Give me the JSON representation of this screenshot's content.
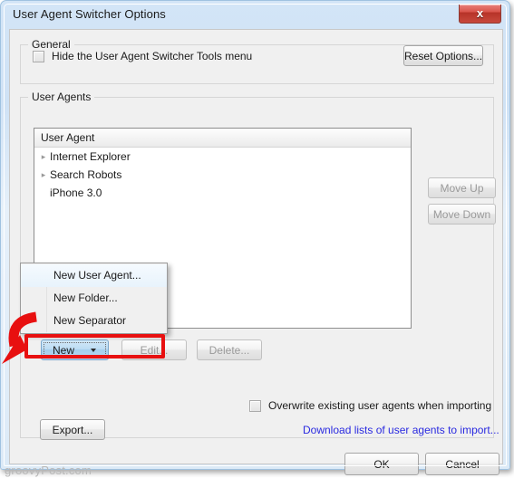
{
  "window": {
    "title": "User Agent Switcher Options",
    "close_glyph": "x"
  },
  "general": {
    "group_label": "General",
    "hide_tools_checkbox": "Hide the User Agent Switcher Tools menu",
    "reset_options_button": "Reset Options..."
  },
  "user_agents": {
    "group_label": "User Agents",
    "column_header": "User Agent",
    "rows": [
      {
        "label": "Internet Explorer",
        "expandable": true,
        "arrow": "▸"
      },
      {
        "label": "Search Robots",
        "expandable": true,
        "arrow": "▸"
      },
      {
        "label": "iPhone 3.0",
        "expandable": false,
        "arrow": ""
      }
    ],
    "move_up_button": "Move Up",
    "move_down_button": "Move Down",
    "new_button": "New",
    "edit_button": "Edit...",
    "delete_button": "Delete...",
    "export_button": "Export...",
    "overwrite_checkbox": "Overwrite existing user agents when importing",
    "download_link": "Download lists of user agents to import..."
  },
  "new_menu": {
    "items": [
      {
        "label": "New User Agent...",
        "highlighted": true
      },
      {
        "label": "New Folder...",
        "highlighted": false
      },
      {
        "label": "New Separator",
        "highlighted": false
      }
    ]
  },
  "dialog_buttons": {
    "ok": "OK",
    "cancel": "Cancel"
  },
  "watermark": "groovyPost.com",
  "colors": {
    "accent_blue": "#2a2ae0",
    "annotation_red": "#e81010",
    "title_gradient_start": "#d3e5f7",
    "close_button_red": "#b63328",
    "client_bg": "#f0f0f0"
  }
}
